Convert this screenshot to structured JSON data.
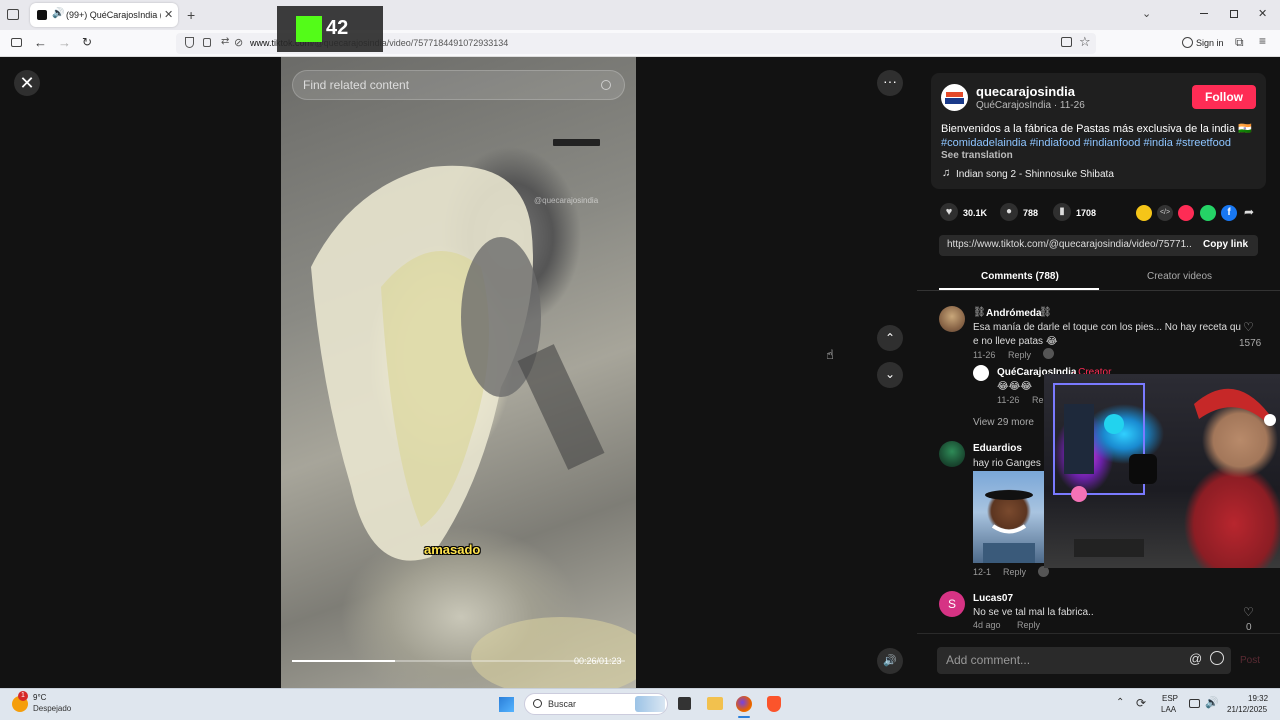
{
  "browser": {
    "tab_title": "(99+) QuéCarajosIndia (@q",
    "url_host": "www.tiktok.com",
    "url_path": "/@quecarajosindia/video/7577184491072933134",
    "sign_in": "Sign in"
  },
  "stream_overlay": {
    "viewer_count": "42"
  },
  "video": {
    "search_placeholder": "Find related content",
    "caption": "amasado",
    "watermark_user": "@quecarajosindia",
    "time": "00:26/01:23",
    "progress": 0.31
  },
  "post": {
    "username": "quecarajosindia",
    "display_name": "QuéCarajosIndia · 11-26",
    "follow_label": "Follow",
    "description": "Bienvenidos a la fábrica de Pastas más exclusiva de la india 🇮🇳",
    "hashtags": [
      "#comidadelaindia",
      "#indiafood",
      "#indianfood",
      "#india",
      "#streetfood"
    ],
    "see_translation": "See translation",
    "music": "Indian song 2 - Shinnosuke Shibata",
    "likes": "30.1K",
    "comments": "788",
    "saves": "1708",
    "link": "https://www.tiktok.com/@quecarajosindia/video/75771...",
    "copy_link": "Copy link"
  },
  "tabs": {
    "comments": "Comments (788)",
    "creator": "Creator videos"
  },
  "comments": [
    {
      "name": "Andrómeda",
      "text_1": "Esa manía de darle el toque con los pies... No hay receta qu",
      "text_2": "e no lleve patas 😂",
      "date": "11-26",
      "reply": "Reply",
      "likes": "1576"
    },
    {
      "name": "QuéCarajosIndia",
      "creator_badge": "· Creator",
      "text": "😂😂😂",
      "date": "11-26",
      "reply": "Re"
    },
    {
      "view_more": "View 29 more"
    },
    {
      "name": "Eduardios",
      "text": "hay rio Ganges h",
      "date": "12-1",
      "reply": "Reply"
    },
    {
      "name": "Lucas07",
      "initial": "S",
      "text": "No se ve tal mal la fabrica..",
      "date": "4d ago",
      "reply": "Reply",
      "likes": "0"
    }
  ],
  "comment_input": {
    "placeholder": "Add comment...",
    "post": "Post"
  },
  "taskbar": {
    "weather_badge": "1",
    "temperature": "9°C",
    "weather": "Despejado",
    "search": "Buscar",
    "lang_1": "ESP",
    "lang_2": "LAA",
    "time": "19:32",
    "date": "21/12/2025"
  }
}
